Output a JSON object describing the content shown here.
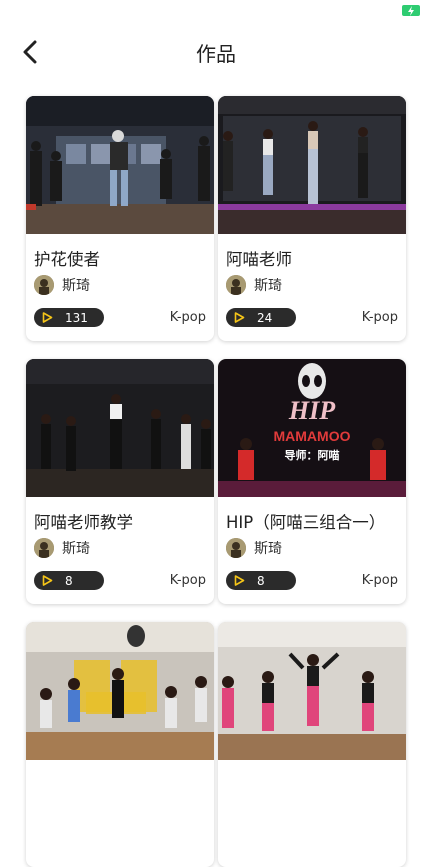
{
  "header": {
    "title": "作品"
  },
  "works": [
    {
      "title": "护花使者",
      "author": "斯琦",
      "plays": "131",
      "genre": "K-pop"
    },
    {
      "title": "阿喵老师",
      "author": "斯琦",
      "plays": "24",
      "genre": "K-pop"
    },
    {
      "title": "阿喵老师教学",
      "author": "斯琦",
      "plays": "8",
      "genre": "K-pop"
    },
    {
      "title": "HIP（阿喵三组合一）",
      "author": "斯琦",
      "plays": "8",
      "genre": "K-pop"
    },
    {
      "title": "",
      "author": "",
      "plays": "",
      "genre": ""
    },
    {
      "title": "",
      "author": "",
      "plays": "",
      "genre": ""
    }
  ],
  "thumb_texts": {
    "hip_logo": "HIP",
    "hip_band": "MAMAMOO",
    "hip_teacher": "导师：阿喵"
  },
  "colors": {
    "accent": "#f5c518",
    "badge_bg": "#2b2b2b",
    "battery": "#2ecc71"
  }
}
